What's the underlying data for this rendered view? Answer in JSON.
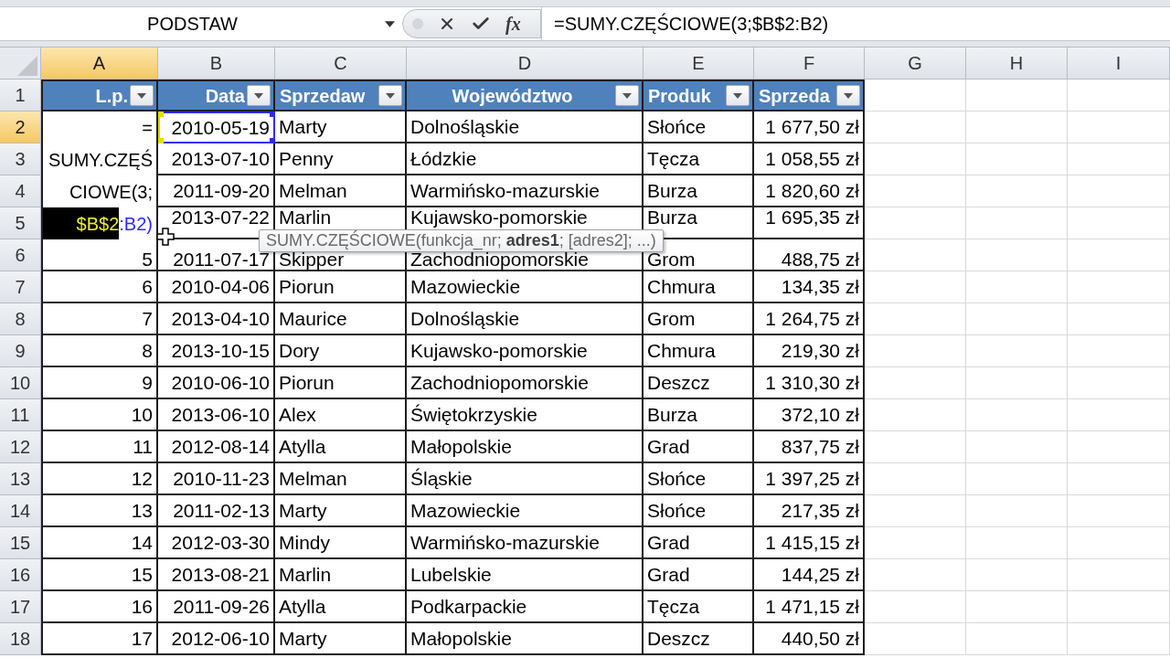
{
  "formula_bar": {
    "name_box": "PODSTAW",
    "function_button": "fx",
    "formula": "=SUMY.CZĘŚCIOWE(3;$B$2:B2)"
  },
  "columns": [
    {
      "label": "A",
      "selected": true
    },
    {
      "label": "B",
      "selected": false
    },
    {
      "label": "C",
      "selected": false
    },
    {
      "label": "D",
      "selected": false
    },
    {
      "label": "E",
      "selected": false
    },
    {
      "label": "F",
      "selected": false
    },
    {
      "label": "G",
      "selected": false
    },
    {
      "label": "H",
      "selected": false
    },
    {
      "label": "I",
      "selected": false
    }
  ],
  "row_headers": [
    {
      "label": "1",
      "selected": false
    },
    {
      "label": "2",
      "selected": true
    },
    {
      "label": "3",
      "selected": false
    },
    {
      "label": "4",
      "selected": false
    },
    {
      "label": "5",
      "selected": false
    },
    {
      "label": "6",
      "selected": false
    },
    {
      "label": "7",
      "selected": false
    },
    {
      "label": "8",
      "selected": false
    },
    {
      "label": "9",
      "selected": false
    },
    {
      "label": "10",
      "selected": false
    },
    {
      "label": "11",
      "selected": false
    },
    {
      "label": "12",
      "selected": false
    },
    {
      "label": "13",
      "selected": false
    },
    {
      "label": "14",
      "selected": false
    },
    {
      "label": "15",
      "selected": false
    },
    {
      "label": "16",
      "selected": false
    },
    {
      "label": "17",
      "selected": false
    },
    {
      "label": "18",
      "selected": false
    }
  ],
  "table": {
    "headers": [
      "L.p.",
      "Data",
      "Sprzedaw",
      "Województwo",
      "Produk",
      "Sprzeda"
    ],
    "rows": [
      {
        "date": "2010-05-19",
        "seller": "Marty",
        "region": "Dolnośląskie",
        "product": "Słońce",
        "sales": "1 677,50 zł",
        "reference_highlight": true
      },
      {
        "date": "2013-07-10",
        "seller": "Penny",
        "region": "Łódzkie",
        "product": "Tęcza",
        "sales": "1 058,55 zł",
        "reference_highlight": false
      },
      {
        "date": "2011-09-20",
        "seller": "Melman",
        "region": "Warmińsko-mazurskie",
        "product": "Burza",
        "sales": "1 820,60 zł",
        "reference_highlight": false
      },
      {
        "date": "2013-07-22",
        "seller": "Marlin",
        "region": "Kujawsko-pomorskie",
        "product": "Burza",
        "sales": "1 695,35 zł",
        "reference_highlight": false
      },
      {
        "lp": "5",
        "date": "2011-07-17",
        "seller": "Skipper",
        "region": "Zachodniopomorskie",
        "product": "Grom",
        "sales": "488,75 zł",
        "reference_highlight": false
      },
      {
        "lp": "6",
        "date": "2010-04-06",
        "seller": "Piorun",
        "region": "Mazowieckie",
        "product": "Chmura",
        "sales": "134,35 zł",
        "reference_highlight": false
      },
      {
        "lp": "7",
        "date": "2013-04-10",
        "seller": "Maurice",
        "region": "Dolnośląskie",
        "product": "Grom",
        "sales": "1 264,75 zł",
        "reference_highlight": false
      },
      {
        "lp": "8",
        "date": "2013-10-15",
        "seller": "Dory",
        "region": "Kujawsko-pomorskie",
        "product": "Chmura",
        "sales": "219,30 zł",
        "reference_highlight": false
      },
      {
        "lp": "9",
        "date": "2010-06-10",
        "seller": "Piorun",
        "region": "Zachodniopomorskie",
        "product": "Deszcz",
        "sales": "1 310,30 zł",
        "reference_highlight": false
      },
      {
        "lp": "10",
        "date": "2013-06-10",
        "seller": "Alex",
        "region": "Świętokrzyskie",
        "product": "Burza",
        "sales": "372,10 zł",
        "reference_highlight": false
      },
      {
        "lp": "11",
        "date": "2012-08-14",
        "seller": "Atylla",
        "region": "Małopolskie",
        "product": "Grad",
        "sales": "837,75 zł",
        "reference_highlight": false
      },
      {
        "lp": "12",
        "date": "2010-11-23",
        "seller": "Melman",
        "region": "Śląskie",
        "product": "Słońce",
        "sales": "1 397,25 zł",
        "reference_highlight": false
      },
      {
        "lp": "13",
        "date": "2011-02-13",
        "seller": "Marty",
        "region": "Mazowieckie",
        "product": "Słońce",
        "sales": "217,35 zł",
        "reference_highlight": false
      },
      {
        "lp": "14",
        "date": "2012-03-30",
        "seller": "Mindy",
        "region": "Warmińsko-mazurskie",
        "product": "Grad",
        "sales": "1 415,15 zł",
        "reference_highlight": false
      },
      {
        "lp": "15",
        "date": "2013-08-21",
        "seller": "Marlin",
        "region": "Lubelskie",
        "product": "Grad",
        "sales": "144,25 zł",
        "reference_highlight": false
      },
      {
        "lp": "16",
        "date": "2011-09-26",
        "seller": "Atylla",
        "region": "Podkarpackie",
        "product": "Tęcza",
        "sales": "1 471,15 zł",
        "reference_highlight": false
      },
      {
        "lp": "17",
        "date": "2012-06-10",
        "seller": "Marty",
        "region": "Małopolskie",
        "product": "Deszcz",
        "sales": "440,50 zł",
        "reference_highlight": false
      }
    ]
  },
  "cell_editor": {
    "lines": [
      "=",
      "SUMY.CZĘŚ",
      "CIOWE(3;"
    ],
    "last_line": [
      {
        "text": "$B$2",
        "selected": true
      },
      {
        "text": ":B2)",
        "selected": false
      }
    ]
  },
  "tooltip": {
    "text": "SUMY.CZĘŚCIOWE(funkcja_nr; **adres1**; [adres2]; ...)"
  }
}
